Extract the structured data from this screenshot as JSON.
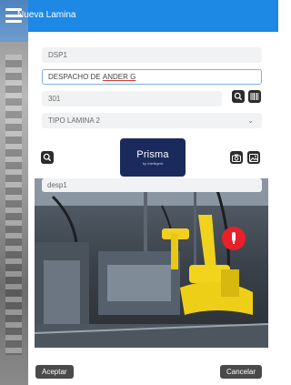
{
  "header": {
    "title": "Nueva Lamina"
  },
  "form": {
    "code": "DSP1",
    "description_prefix": "DESPACHO DE ",
    "description_underlined": "ANDER G",
    "number": "301",
    "lamina_type": "TIPO LAMINA 2",
    "photo_caption": "desp1"
  },
  "logo": {
    "name": "Prisma",
    "subtitle": "by Intelligent"
  },
  "icons": {
    "hamburger": "menu-icon",
    "search": "search-icon",
    "barcode": "barcode-icon",
    "camera": "camera-icon",
    "gallery": "image-icon",
    "chevron": "chevron-down-icon"
  },
  "actions": {
    "accept": "Aceptar",
    "cancel": "Cancelar"
  },
  "colors": {
    "header": "#1e88e5",
    "button": "#4a4a4a",
    "marker": "#e8202a"
  }
}
